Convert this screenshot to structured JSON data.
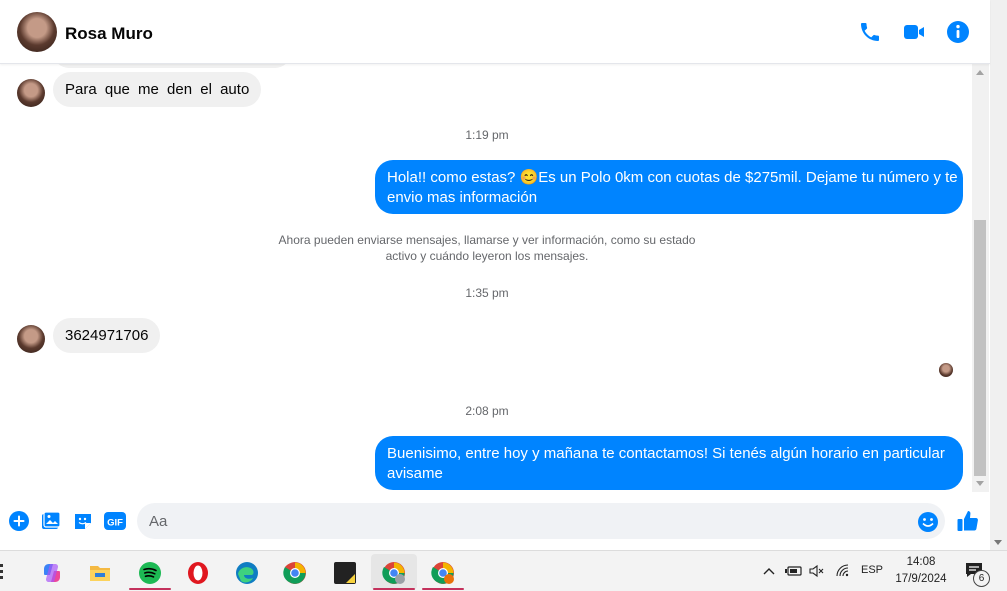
{
  "header": {
    "contact_name": "Rosa Muro",
    "icons": [
      "phone-icon",
      "video-icon",
      "info-icon"
    ],
    "accent_color": "#0084ff"
  },
  "messages": {
    "m1": "Para que me den el auto",
    "t1": "1:19 pm",
    "m2_line1": "Hola!! como estas? 😊Es un Polo 0km con cuotas de $275mil. Dejame tu número y te",
    "m2_line2": "envio mas información",
    "system_line1": "Ahora pueden enviarse mensajes, llamarse y ver información, como su estado",
    "system_line2": "activo y cuándo leyeron los mensajes.",
    "t2": "1:35 pm",
    "m3": "3624971706",
    "t3": "2:08 pm",
    "m4_line1": "Buenisimo, entre hoy y mañana te contactamos! Si tenés algún horario en particular",
    "m4_line2": "avisame"
  },
  "composer": {
    "placeholder": "Aa",
    "gif_label": "GIF",
    "icons": [
      "plus-icon",
      "image-icon",
      "sticker-icon",
      "gif-icon",
      "emoji-icon",
      "like-icon"
    ]
  },
  "taskbar": {
    "apps": [
      "copilot",
      "file-explorer",
      "spotify",
      "opera",
      "edge",
      "chrome",
      "sticky-notes",
      "chrome-profile-y",
      "chrome-profile-r"
    ],
    "language": "ESP",
    "time": "14:08",
    "date": "17/9/2024",
    "notification_count": "6"
  }
}
